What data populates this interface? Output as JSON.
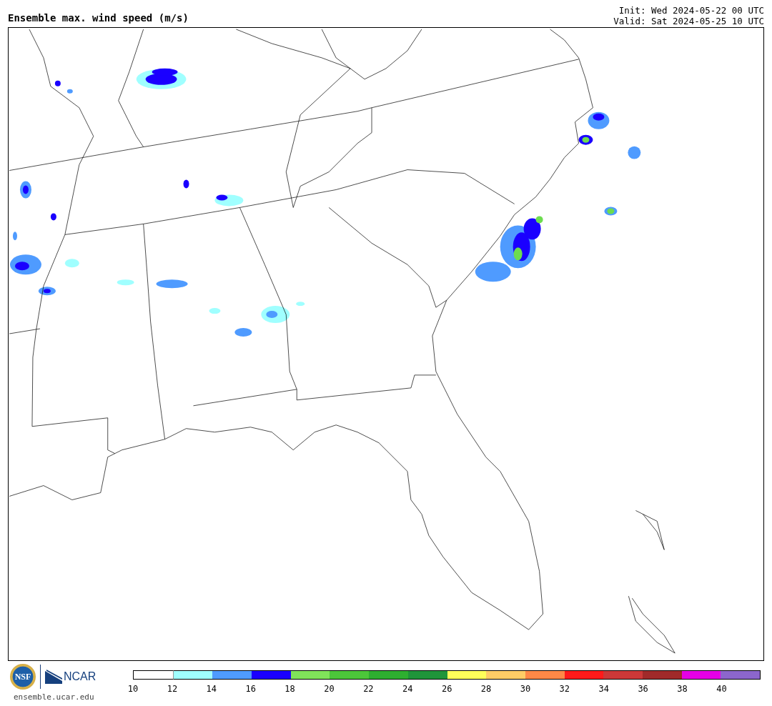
{
  "title": "Ensemble max. wind speed (m/s)",
  "init": "Init: Wed 2024-05-22 00 UTC",
  "valid": "Valid: Sat 2024-05-25 10 UTC",
  "logos": [
    {
      "kind": "nsf",
      "text": "NSF"
    },
    {
      "kind": "ncar",
      "text": "NCAR"
    }
  ],
  "url": "ensemble.ucar.edu",
  "colorbar": {
    "segments": [
      {
        "color": "#ffffff"
      },
      {
        "color": "#a0ffff"
      },
      {
        "color": "#4f9bff"
      },
      {
        "color": "#1a00ff"
      },
      {
        "color": "#80e35a"
      },
      {
        "color": "#4cc63a"
      },
      {
        "color": "#2eaf30"
      },
      {
        "color": "#1f953a"
      },
      {
        "color": "#ffff5a"
      },
      {
        "color": "#ffcc66"
      },
      {
        "color": "#ff8847"
      },
      {
        "color": "#ff1a1a"
      },
      {
        "color": "#cc3838"
      },
      {
        "color": "#a02a2a"
      },
      {
        "color": "#e600e6"
      },
      {
        "color": "#8c66cc"
      }
    ],
    "ticks": [
      "10",
      "12",
      "14",
      "16",
      "18",
      "20",
      "22",
      "24",
      "26",
      "28",
      "30",
      "32",
      "34",
      "36",
      "38",
      "40"
    ]
  }
}
